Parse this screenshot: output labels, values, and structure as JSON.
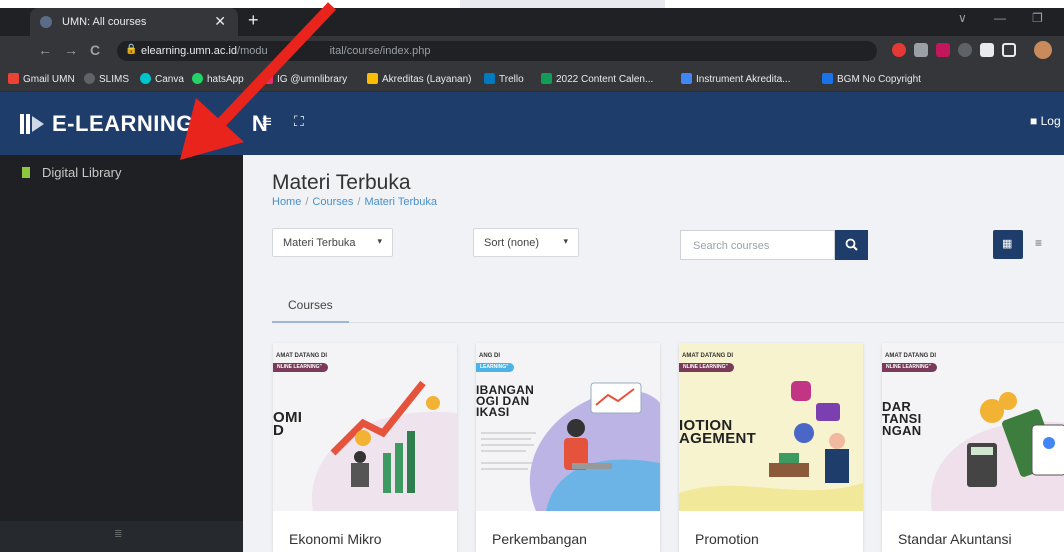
{
  "browser": {
    "tab_title": "UMN: All courses",
    "tab_close": "✕",
    "new_tab": "+",
    "url_host": "elearning.umn.ac.id",
    "url_path": "/modu",
    "url_path_tail": "ital/course/index.php",
    "window_controls": [
      "∨",
      "—",
      "❐"
    ],
    "nav": {
      "back": "←",
      "forward": "→",
      "reload": "C"
    }
  },
  "bookmarks": [
    {
      "label": "Gmail UMN",
      "color": "#ea4335"
    },
    {
      "label": "SLIMS",
      "color": "#5f6368"
    },
    {
      "label": "Canva",
      "color": "#00c4cc"
    },
    {
      "label": "hatsApp",
      "color": "#25d366"
    },
    {
      "label": "IG @umnlibrary",
      "color": "#e1306c"
    },
    {
      "label": "Akreditas (Layanan)",
      "color": "#fbbc04"
    },
    {
      "label": "Trello",
      "color": "#0079bf"
    },
    {
      "label": "2022 Content Calen...",
      "color": "#0f9d58"
    },
    {
      "label": "Instrument Akredita...",
      "color": "#4285f4"
    },
    {
      "label": "BGM No Copyright",
      "color": "#1a73e8"
    }
  ],
  "header": {
    "brand": "E-LEARNING",
    "brand_tail": "N",
    "hamburger_icon": "≡",
    "expand_icon": "⛶",
    "login_label": "Log"
  },
  "sidebar": {
    "items": [
      {
        "label": "Digital Library"
      }
    ],
    "footer_icon": "≣"
  },
  "main": {
    "title": "Materi Terbuka",
    "breadcrumb": [
      "Home",
      "Courses",
      "Materi Terbuka"
    ],
    "breadcrumb_sep": "/",
    "category_select": "Materi Terbuka",
    "sort_select": "Sort (none)",
    "caret": "▾",
    "search_placeholder": "Search courses",
    "search_icon": "🔍",
    "view_grid_icon": "▦",
    "view_list_icon": "≡",
    "tab_courses": "Courses",
    "courses": [
      {
        "name": "Ekonomi Mikro",
        "banner_top": "AMAT DATANG DI",
        "banner_pill": "NLINE LEARNING\"",
        "cover_lines": [
          "OMI",
          "D"
        ]
      },
      {
        "name": "Perkembangan",
        "banner_top": "ANG DI",
        "banner_pill": "LEARNING\"",
        "cover_lines": [
          "IBANGAN",
          "OGI DAN",
          "IKASI"
        ]
      },
      {
        "name": "Promotion",
        "banner_top": "AMAT DATANG DI",
        "banner_pill": "NLINE LEARNING\"",
        "cover_lines": [
          "IOTION",
          "AGEMENT"
        ]
      },
      {
        "name": "Standar Akuntansi",
        "banner_top": "AMAT DATANG DI",
        "banner_pill": "NLINE LEARNING\"",
        "cover_lines": [
          "DAR",
          "TANSI",
          "NGAN"
        ]
      }
    ]
  },
  "colors": {
    "header_blue": "#1f3d6b",
    "sidebar_dark": "#1e2023",
    "annotation_arrow": "#e8241c"
  }
}
